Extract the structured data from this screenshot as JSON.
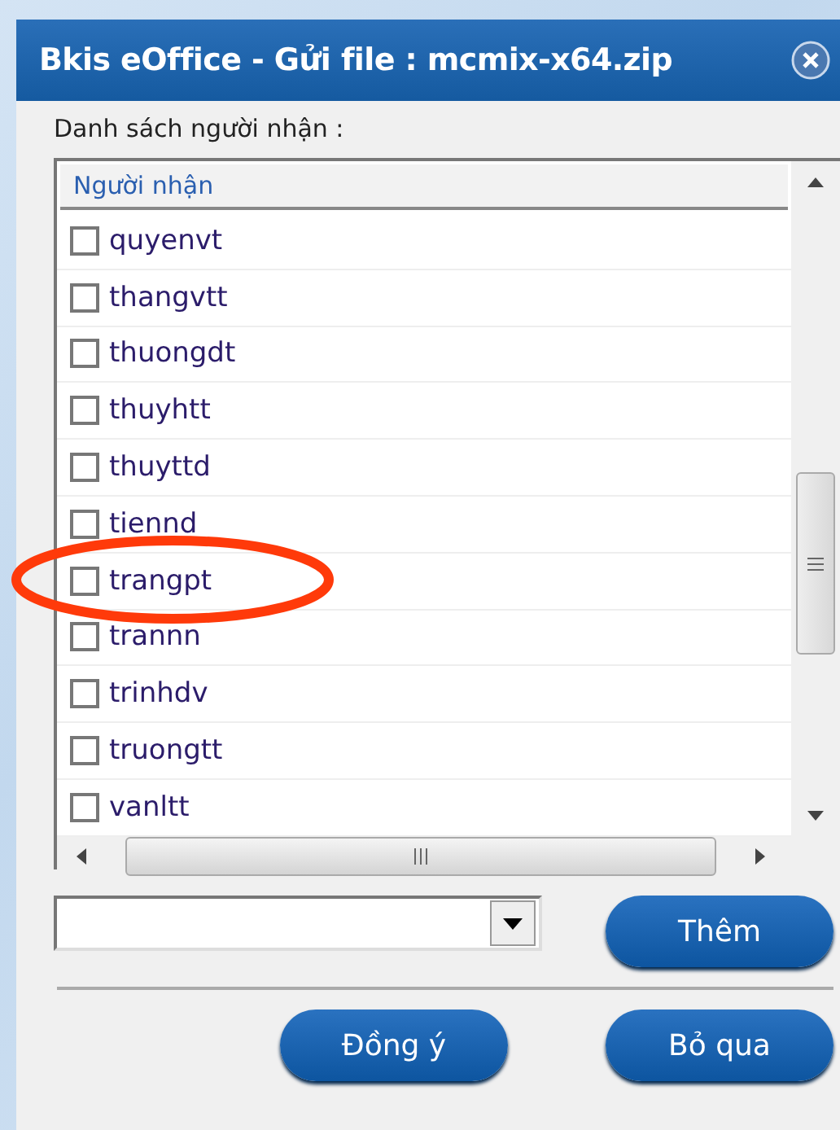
{
  "window": {
    "title": "Bkis eOffice - Gửi file : mcmix-x64.zip"
  },
  "list_label": "Danh sách người nhận :",
  "table": {
    "columns": [
      "Người nhận"
    ],
    "rows": [
      {
        "name": "quyenvt",
        "checked": false
      },
      {
        "name": "thangvtt",
        "checked": false
      },
      {
        "name": "thuongdt",
        "checked": false
      },
      {
        "name": "thuyhtt",
        "checked": false
      },
      {
        "name": "thuyttd",
        "checked": false
      },
      {
        "name": "tiennd",
        "checked": false
      },
      {
        "name": "trangpt",
        "checked": false
      },
      {
        "name": "trannn",
        "checked": false
      },
      {
        "name": "trinhdv",
        "checked": false
      },
      {
        "name": "truongtt",
        "checked": false
      },
      {
        "name": "vanltt",
        "checked": false
      }
    ]
  },
  "add_button": "Thêm",
  "buttons": [
    "Đồng ý",
    "Bỏ qua"
  ]
}
